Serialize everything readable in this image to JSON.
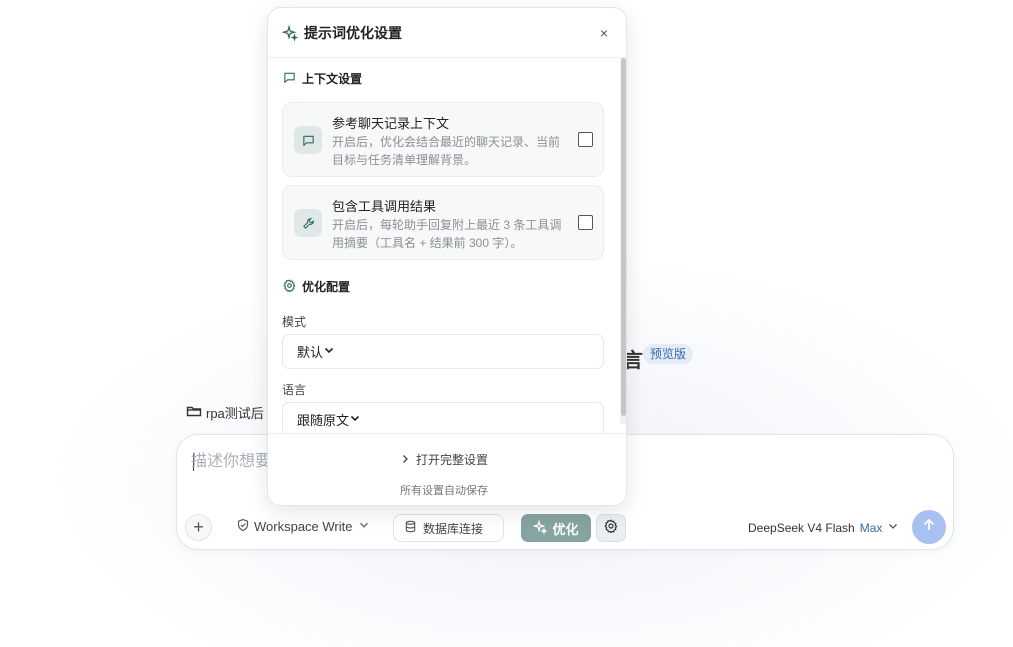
{
  "popup": {
    "title": "提示词优化设置",
    "close_label": "×",
    "context_section": {
      "title": "上下文设置",
      "cards": [
        {
          "title": "参考聊天记录上下文",
          "description": "开启后，优化会结合最近的聊天记录、当前目标与任务清单理解背景。",
          "checked": false
        },
        {
          "title": "包含工具调用结果",
          "description": "开启后，每轮助手回复附上最近 3 条工具调用摘要（工具名 + 结果前 300 字）。",
          "checked": false
        }
      ]
    },
    "optimize_section": {
      "title": "优化配置",
      "mode_label": "模式",
      "mode_value": "默认",
      "language_label": "语言",
      "language_value": "跟随原文"
    },
    "footer": {
      "open_full_label": "打开完整设置",
      "autosave_text": "所有设置自动保存"
    }
  },
  "background": {
    "title_fragment": "言",
    "preview_badge": "预览版",
    "folder_label": "rpa测试后"
  },
  "composer": {
    "placeholder": "描述你想要",
    "plus_label": "+",
    "workspace_label": "Workspace Write",
    "db_label": "数据库连接",
    "optimize_label": "优化",
    "model_name": "DeepSeek V4 Flash",
    "model_tier": "Max"
  },
  "colors": {
    "optimize_button": "#86a4a1",
    "send_button": "#a8c1f0",
    "badge_bg": "#e4edf7",
    "badge_text": "#3a6aa8"
  },
  "icons": [
    "sparkle-icon",
    "close-icon",
    "chat-bubble-icon",
    "wrench-icon",
    "gear-icon",
    "chevron-down-icon",
    "chevron-right-icon",
    "folder-icon",
    "shield-icon",
    "database-icon",
    "arrow-up-icon"
  ]
}
